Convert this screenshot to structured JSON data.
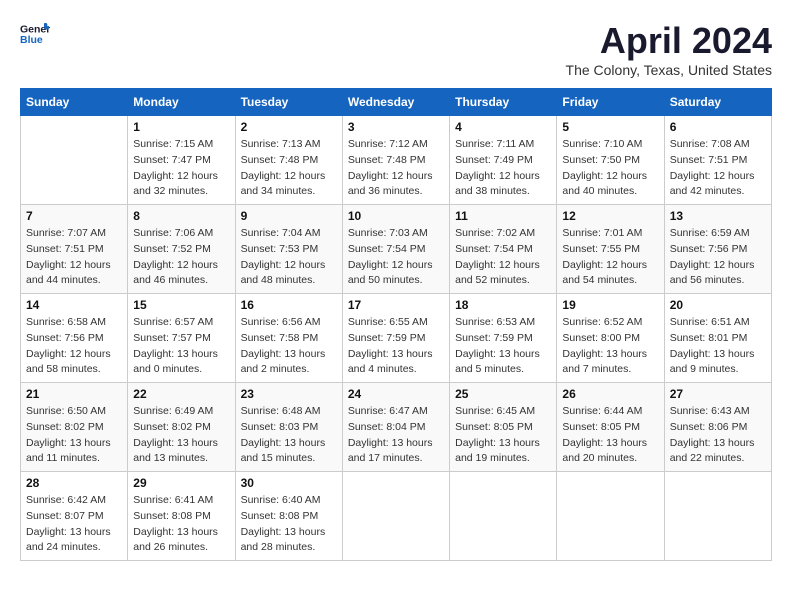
{
  "header": {
    "logo_general": "General",
    "logo_blue": "Blue",
    "month_title": "April 2024",
    "location": "The Colony, Texas, United States"
  },
  "days_of_week": [
    "Sunday",
    "Monday",
    "Tuesday",
    "Wednesday",
    "Thursday",
    "Friday",
    "Saturday"
  ],
  "weeks": [
    [
      {
        "day": "",
        "sunrise": "",
        "sunset": "",
        "daylight": ""
      },
      {
        "day": "1",
        "sunrise": "Sunrise: 7:15 AM",
        "sunset": "Sunset: 7:47 PM",
        "daylight": "Daylight: 12 hours and 32 minutes."
      },
      {
        "day": "2",
        "sunrise": "Sunrise: 7:13 AM",
        "sunset": "Sunset: 7:48 PM",
        "daylight": "Daylight: 12 hours and 34 minutes."
      },
      {
        "day": "3",
        "sunrise": "Sunrise: 7:12 AM",
        "sunset": "Sunset: 7:48 PM",
        "daylight": "Daylight: 12 hours and 36 minutes."
      },
      {
        "day": "4",
        "sunrise": "Sunrise: 7:11 AM",
        "sunset": "Sunset: 7:49 PM",
        "daylight": "Daylight: 12 hours and 38 minutes."
      },
      {
        "day": "5",
        "sunrise": "Sunrise: 7:10 AM",
        "sunset": "Sunset: 7:50 PM",
        "daylight": "Daylight: 12 hours and 40 minutes."
      },
      {
        "day": "6",
        "sunrise": "Sunrise: 7:08 AM",
        "sunset": "Sunset: 7:51 PM",
        "daylight": "Daylight: 12 hours and 42 minutes."
      }
    ],
    [
      {
        "day": "7",
        "sunrise": "Sunrise: 7:07 AM",
        "sunset": "Sunset: 7:51 PM",
        "daylight": "Daylight: 12 hours and 44 minutes."
      },
      {
        "day": "8",
        "sunrise": "Sunrise: 7:06 AM",
        "sunset": "Sunset: 7:52 PM",
        "daylight": "Daylight: 12 hours and 46 minutes."
      },
      {
        "day": "9",
        "sunrise": "Sunrise: 7:04 AM",
        "sunset": "Sunset: 7:53 PM",
        "daylight": "Daylight: 12 hours and 48 minutes."
      },
      {
        "day": "10",
        "sunrise": "Sunrise: 7:03 AM",
        "sunset": "Sunset: 7:54 PM",
        "daylight": "Daylight: 12 hours and 50 minutes."
      },
      {
        "day": "11",
        "sunrise": "Sunrise: 7:02 AM",
        "sunset": "Sunset: 7:54 PM",
        "daylight": "Daylight: 12 hours and 52 minutes."
      },
      {
        "day": "12",
        "sunrise": "Sunrise: 7:01 AM",
        "sunset": "Sunset: 7:55 PM",
        "daylight": "Daylight: 12 hours and 54 minutes."
      },
      {
        "day": "13",
        "sunrise": "Sunrise: 6:59 AM",
        "sunset": "Sunset: 7:56 PM",
        "daylight": "Daylight: 12 hours and 56 minutes."
      }
    ],
    [
      {
        "day": "14",
        "sunrise": "Sunrise: 6:58 AM",
        "sunset": "Sunset: 7:56 PM",
        "daylight": "Daylight: 12 hours and 58 minutes."
      },
      {
        "day": "15",
        "sunrise": "Sunrise: 6:57 AM",
        "sunset": "Sunset: 7:57 PM",
        "daylight": "Daylight: 13 hours and 0 minutes."
      },
      {
        "day": "16",
        "sunrise": "Sunrise: 6:56 AM",
        "sunset": "Sunset: 7:58 PM",
        "daylight": "Daylight: 13 hours and 2 minutes."
      },
      {
        "day": "17",
        "sunrise": "Sunrise: 6:55 AM",
        "sunset": "Sunset: 7:59 PM",
        "daylight": "Daylight: 13 hours and 4 minutes."
      },
      {
        "day": "18",
        "sunrise": "Sunrise: 6:53 AM",
        "sunset": "Sunset: 7:59 PM",
        "daylight": "Daylight: 13 hours and 5 minutes."
      },
      {
        "day": "19",
        "sunrise": "Sunrise: 6:52 AM",
        "sunset": "Sunset: 8:00 PM",
        "daylight": "Daylight: 13 hours and 7 minutes."
      },
      {
        "day": "20",
        "sunrise": "Sunrise: 6:51 AM",
        "sunset": "Sunset: 8:01 PM",
        "daylight": "Daylight: 13 hours and 9 minutes."
      }
    ],
    [
      {
        "day": "21",
        "sunrise": "Sunrise: 6:50 AM",
        "sunset": "Sunset: 8:02 PM",
        "daylight": "Daylight: 13 hours and 11 minutes."
      },
      {
        "day": "22",
        "sunrise": "Sunrise: 6:49 AM",
        "sunset": "Sunset: 8:02 PM",
        "daylight": "Daylight: 13 hours and 13 minutes."
      },
      {
        "day": "23",
        "sunrise": "Sunrise: 6:48 AM",
        "sunset": "Sunset: 8:03 PM",
        "daylight": "Daylight: 13 hours and 15 minutes."
      },
      {
        "day": "24",
        "sunrise": "Sunrise: 6:47 AM",
        "sunset": "Sunset: 8:04 PM",
        "daylight": "Daylight: 13 hours and 17 minutes."
      },
      {
        "day": "25",
        "sunrise": "Sunrise: 6:45 AM",
        "sunset": "Sunset: 8:05 PM",
        "daylight": "Daylight: 13 hours and 19 minutes."
      },
      {
        "day": "26",
        "sunrise": "Sunrise: 6:44 AM",
        "sunset": "Sunset: 8:05 PM",
        "daylight": "Daylight: 13 hours and 20 minutes."
      },
      {
        "day": "27",
        "sunrise": "Sunrise: 6:43 AM",
        "sunset": "Sunset: 8:06 PM",
        "daylight": "Daylight: 13 hours and 22 minutes."
      }
    ],
    [
      {
        "day": "28",
        "sunrise": "Sunrise: 6:42 AM",
        "sunset": "Sunset: 8:07 PM",
        "daylight": "Daylight: 13 hours and 24 minutes."
      },
      {
        "day": "29",
        "sunrise": "Sunrise: 6:41 AM",
        "sunset": "Sunset: 8:08 PM",
        "daylight": "Daylight: 13 hours and 26 minutes."
      },
      {
        "day": "30",
        "sunrise": "Sunrise: 6:40 AM",
        "sunset": "Sunset: 8:08 PM",
        "daylight": "Daylight: 13 hours and 28 minutes."
      },
      {
        "day": "",
        "sunrise": "",
        "sunset": "",
        "daylight": ""
      },
      {
        "day": "",
        "sunrise": "",
        "sunset": "",
        "daylight": ""
      },
      {
        "day": "",
        "sunrise": "",
        "sunset": "",
        "daylight": ""
      },
      {
        "day": "",
        "sunrise": "",
        "sunset": "",
        "daylight": ""
      }
    ]
  ]
}
